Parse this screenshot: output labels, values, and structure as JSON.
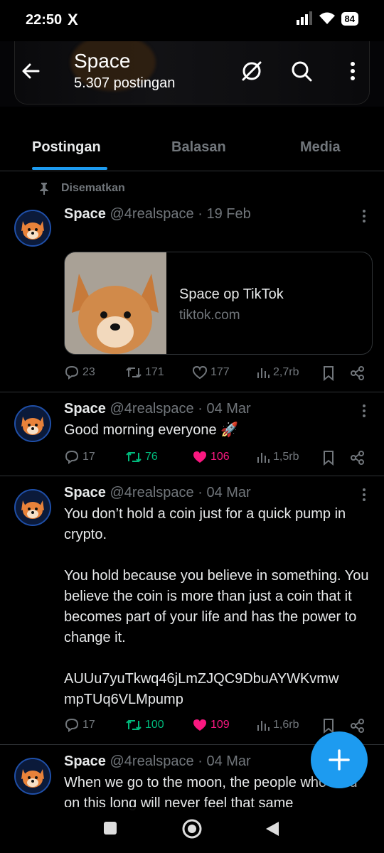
{
  "status_bar": {
    "time": "22:50",
    "x_logo": "X",
    "battery": "84",
    "icons": [
      "signal-icon",
      "wifi-icon",
      "battery-icon"
    ]
  },
  "header": {
    "title": "Space",
    "subtitle": "5.307 postingan",
    "icons": [
      "back-arrow-icon",
      "no-grok-icon",
      "search-icon",
      "more-vertical-icon"
    ]
  },
  "tabs": [
    {
      "label": "Postingan",
      "active": true
    },
    {
      "label": "Balasan",
      "active": false
    },
    {
      "label": "Media",
      "active": false
    }
  ],
  "pinned_label": "Disematkan",
  "tweets": [
    {
      "name": "Space",
      "handle": "@4realspace",
      "date": "19 Feb",
      "text": "",
      "card": {
        "title": "Space op TikTok",
        "domain": "tiktok.com"
      },
      "replies": "23",
      "reposts": "171",
      "likes": "177",
      "views": "2,7rb",
      "liked": false,
      "reposted": false
    },
    {
      "name": "Space",
      "handle": "@4realspace",
      "date": "04 Mar",
      "text": "Good morning everyone 🚀",
      "replies": "17",
      "reposts": "76",
      "likes": "106",
      "views": "1,5rb",
      "liked": true,
      "reposted": true
    },
    {
      "name": "Space",
      "handle": "@4realspace",
      "date": "04 Mar",
      "text": "You don’t hold a coin just for a quick pump in crypto.\n\nYou hold because you believe in something. You believe the coin is more than just a coin that it becomes part of your life and has the power to change it.\n\nAUUu7yuTkwq46jLmZJQC9DbuAYWKvmw mpTUq6VLMpump",
      "replies": "17",
      "reposts": "100",
      "likes": "109",
      "views": "1,6rb",
      "liked": true,
      "reposted": true
    },
    {
      "name": "Space",
      "handle": "@4realspace",
      "date": "04 Mar",
      "text": "When we go to the moon, the people who held on this long will never feel that same"
    }
  ],
  "colors": {
    "accent": "#1d9bf0",
    "like": "#f91880",
    "repost": "#00ba7c",
    "muted": "#71767b"
  }
}
